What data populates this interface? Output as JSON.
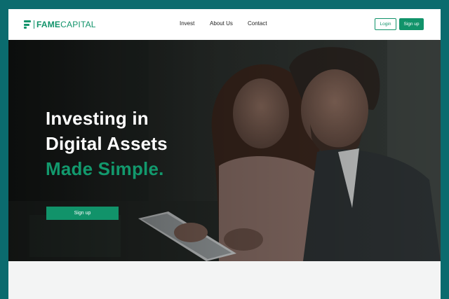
{
  "brand": {
    "name_bold": "FAME",
    "name_rest": "CAPITAL"
  },
  "nav": {
    "items": [
      "Invest",
      "About Us",
      "Contact"
    ]
  },
  "auth": {
    "login_label": "Login",
    "signup_label": "Sign up"
  },
  "hero": {
    "line1": "Investing in",
    "line2": "Digital Assets",
    "line3": "Made Simple.",
    "cta_label": "Sign up"
  },
  "colors": {
    "accent": "#11936a",
    "frame": "#0b6b6e"
  }
}
